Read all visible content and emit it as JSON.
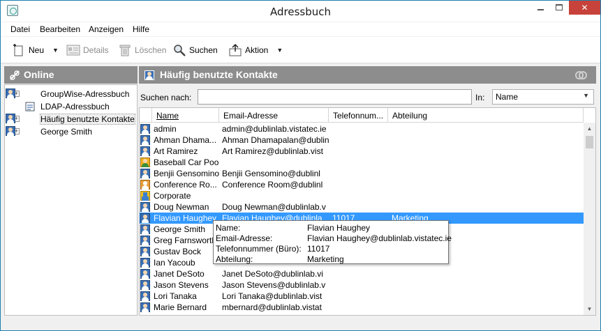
{
  "window": {
    "title": "Adressbuch"
  },
  "menu": [
    "Datei",
    "Bearbeiten",
    "Anzeigen",
    "Hilfe"
  ],
  "toolbar": {
    "new_label": "Neu",
    "details_label": "Details",
    "delete_label": "Löschen",
    "search_label": "Suchen",
    "action_label": "Aktion"
  },
  "left": {
    "header": "Online",
    "items": [
      {
        "label": "GroupWise-Adressbuch",
        "expander": "+",
        "icon": "addressbook-icon"
      },
      {
        "label": "LDAP-Adressbuch",
        "expander": "",
        "icon": "ldap-icon"
      },
      {
        "label": "Häufig benutzte Kontakte",
        "expander": "+",
        "icon": "addressbook-icon"
      },
      {
        "label": "George Smith",
        "expander": "+",
        "icon": "addressbook-icon"
      }
    ]
  },
  "right": {
    "header": "Häufig benutzte Kontakte",
    "search_label": "Suchen nach:",
    "search_value": "",
    "in_label": "In:",
    "in_value": "Name",
    "columns": [
      "Name",
      "Email-Adresse",
      "Telefonnum...",
      "Abteilung"
    ],
    "rows": [
      {
        "type": "person",
        "name": "admin",
        "email": "admin@dublinlab.vistatec.ie",
        "phone": "",
        "dept": ""
      },
      {
        "type": "person",
        "name": "Ahman Dhama...",
        "email": "Ahman Dhamapalan@dublinl",
        "phone": "",
        "dept": ""
      },
      {
        "type": "person",
        "name": "Art Ramirez",
        "email": "Art Ramirez@dublinlab.vist",
        "phone": "",
        "dept": ""
      },
      {
        "type": "group",
        "name": "Baseball Car Pool",
        "email": "",
        "phone": "",
        "dept": ""
      },
      {
        "type": "person",
        "name": "Benjii Gensomino",
        "email": "Benjii Gensomino@dublinl",
        "phone": "",
        "dept": ""
      },
      {
        "type": "resource",
        "name": "Conference Ro...",
        "email": "Conference Room@dublinl",
        "phone": "",
        "dept": ""
      },
      {
        "type": "org",
        "name": "Corporate",
        "email": "",
        "phone": "",
        "dept": ""
      },
      {
        "type": "person",
        "name": "Doug Newman",
        "email": "Doug Newman@dublinlab.v",
        "phone": "",
        "dept": ""
      },
      {
        "type": "person",
        "name": "Flavian Haughey",
        "email": "Flavian Haughey@dublinla",
        "phone": "11017",
        "dept": "Marketing",
        "selected": true
      },
      {
        "type": "person",
        "name": "George Smith",
        "email": "",
        "phone": "",
        "dept": ""
      },
      {
        "type": "person",
        "name": "Greg Farnsworth",
        "email": "",
        "phone": "",
        "dept": ""
      },
      {
        "type": "person",
        "name": "Gustav Bock",
        "email": "",
        "phone": "",
        "dept": ""
      },
      {
        "type": "person",
        "name": "Ian Yacoub",
        "email": "",
        "phone": "",
        "dept": ""
      },
      {
        "type": "person",
        "name": "Janet DeSoto",
        "email": "Janet DeSoto@dublinlab.vi",
        "phone": "",
        "dept": ""
      },
      {
        "type": "person",
        "name": "Jason Stevens",
        "email": "Jason Stevens@dublinlab.v",
        "phone": "",
        "dept": ""
      },
      {
        "type": "person",
        "name": "Lori Tanaka",
        "email": "Lori Tanaka@dublinlab.vist",
        "phone": "",
        "dept": ""
      },
      {
        "type": "person",
        "name": "Marie Bernard",
        "email": "mbernard@dublinlab.vistat",
        "phone": "",
        "dept": ""
      }
    ]
  },
  "tooltip": {
    "rows": [
      {
        "key": "Name:",
        "value": "Flavian Haughey"
      },
      {
        "key": "Email-Adresse:",
        "value": "Flavian Haughey@dublinlab.vistatec.ie"
      },
      {
        "key": "Telefonnummer (Büro):",
        "value": "11017"
      },
      {
        "key": "Abteilung:",
        "value": "Marketing"
      }
    ]
  },
  "colors": {
    "selection": "#3399ff",
    "pane_header": "#8d8d8d",
    "close_button": "#c7423a"
  }
}
